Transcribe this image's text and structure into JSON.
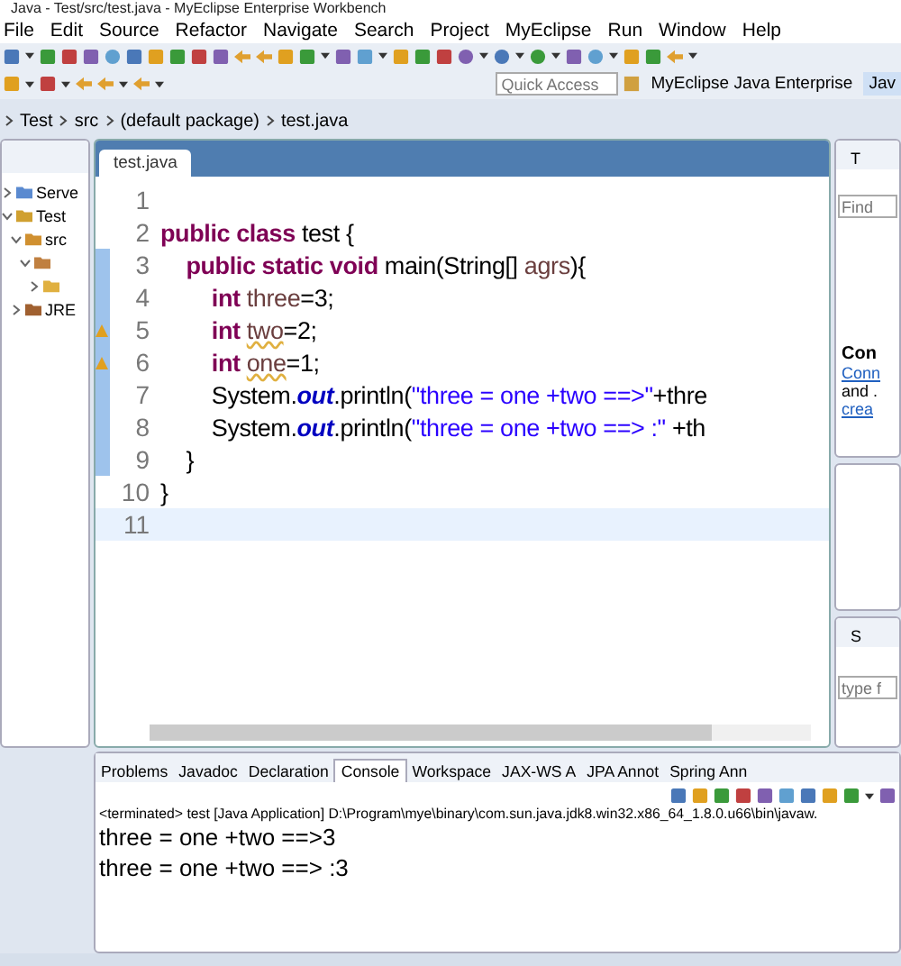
{
  "window": {
    "title": "Java - Test/src/test.java - MyEclipse Enterprise Workbench"
  },
  "menu": [
    "File",
    "Edit",
    "Source",
    "Refactor",
    "Navigate",
    "Search",
    "Project",
    "MyEclipse",
    "Run",
    "Window",
    "Help"
  ],
  "quick_access": {
    "placeholder": "Quick Access"
  },
  "perspectives": [
    {
      "label": "MyEclipse Java Enterprise",
      "selected": false
    },
    {
      "label": "Jav",
      "selected": true
    }
  ],
  "breadcrumb": [
    "Test",
    "src",
    "(default package)",
    "test.java"
  ],
  "package_explorer": {
    "items": [
      {
        "kind": "server",
        "label": "Serve",
        "expanded": false
      },
      {
        "kind": "project",
        "label": "Test",
        "expanded": true,
        "children": [
          {
            "kind": "folder",
            "label": "src",
            "expanded": true,
            "children": [
              {
                "kind": "package",
                "expanded": true,
                "children": [
                  {
                    "kind": "file",
                    "expanded": false
                  }
                ]
              }
            ]
          },
          {
            "kind": "library",
            "label": "JRE",
            "expanded": false
          }
        ]
      }
    ]
  },
  "editor": {
    "tab": {
      "label": "test.java",
      "selected": true
    },
    "lines": [
      {
        "number": "1"
      },
      {
        "number": "2",
        "tokens": [
          {
            "kind": "keyword",
            "text": "public class"
          },
          {
            "kind": "plain",
            "text": " test {"
          }
        ]
      },
      {
        "number": "3",
        "scope": true,
        "tokens": [
          {
            "kind": "keyword",
            "text": "    public static void"
          },
          {
            "kind": "plain",
            "text": " main(String[] "
          },
          {
            "kind": "variable",
            "text": "agrs"
          },
          {
            "kind": "plain",
            "text": "){"
          }
        ]
      },
      {
        "number": "4",
        "scope": true,
        "tokens": [
          {
            "kind": "keyword",
            "text": "        int "
          },
          {
            "kind": "variable",
            "text": "three"
          },
          {
            "kind": "plain",
            "text": "=3;"
          }
        ]
      },
      {
        "number": "5",
        "scope": true,
        "warning": true,
        "tokens": [
          {
            "kind": "keyword",
            "text": "        int "
          },
          {
            "kind": "unused",
            "text": "two"
          },
          {
            "kind": "plain",
            "text": "=2;"
          }
        ]
      },
      {
        "number": "6",
        "scope": true,
        "warning": true,
        "tokens": [
          {
            "kind": "keyword",
            "text": "        int "
          },
          {
            "kind": "unused",
            "text": "one"
          },
          {
            "kind": "plain",
            "text": "=1;"
          }
        ]
      },
      {
        "number": "7",
        "scope": true,
        "tokens": [
          {
            "kind": "plain",
            "text": "        System."
          },
          {
            "kind": "field",
            "text": "out"
          },
          {
            "kind": "plain",
            "text": ".println("
          },
          {
            "kind": "string",
            "text": "\"three = one +two ==>\""
          },
          {
            "kind": "plain",
            "text": "+thre"
          }
        ]
      },
      {
        "number": "8",
        "scope": true,
        "tokens": [
          {
            "kind": "plain",
            "text": "        System."
          },
          {
            "kind": "field",
            "text": "out"
          },
          {
            "kind": "plain",
            "text": ".println("
          },
          {
            "kind": "string",
            "text": "\"three = one +two ==> :\""
          },
          {
            "kind": "plain",
            "text": " +th"
          }
        ]
      },
      {
        "number": "9",
        "scope": true,
        "tokens": [
          {
            "kind": "plain",
            "text": "    }"
          }
        ]
      },
      {
        "number": "10",
        "tokens": [
          {
            "kind": "plain",
            "text": "}"
          }
        ]
      },
      {
        "number": "11",
        "current": true
      }
    ]
  },
  "task_panel": {
    "tab": "T",
    "find": {
      "placeholder": "Find"
    },
    "heading": "Con",
    "link": "Conn",
    "text": "and .",
    "link_2": "crea"
  },
  "side_panel": {
    "tab": "S",
    "filter": {
      "placeholder": "type f"
    }
  },
  "bottom_tabs": [
    {
      "label": "Problems",
      "selected": false
    },
    {
      "label": "Javadoc",
      "selected": false
    },
    {
      "label": "Declaration",
      "selected": false
    },
    {
      "label": "Console",
      "selected": true
    },
    {
      "label": "Workspace",
      "selected": false
    },
    {
      "label": "JAX-WS A",
      "selected": false
    },
    {
      "label": "JPA Annot",
      "selected": false
    },
    {
      "label": "Spring Ann",
      "selected": false
    }
  ],
  "console": {
    "status": "<terminated> test [Java Application] D:\\Program\\mye\\binary\\com.sun.java.jdk8.win32.x86_64_1.8.0.u66\\bin\\javaw.",
    "output": [
      "three = one +two ==>3",
      "three = one +two ==> :3"
    ]
  }
}
